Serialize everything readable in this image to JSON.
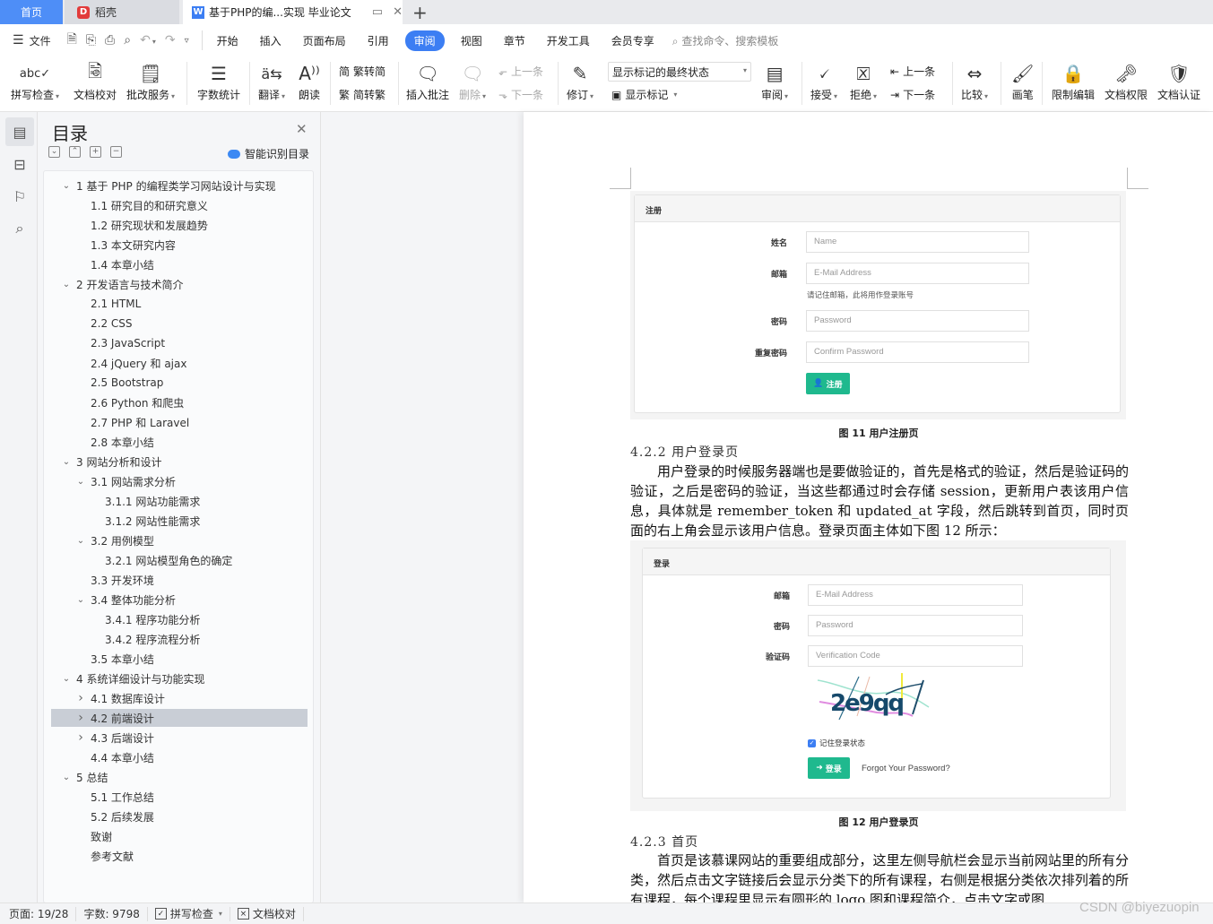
{
  "tabs": {
    "home": "首页",
    "daoke": "稻壳",
    "document": "基于PHP的编...实现 毕业论文"
  },
  "menu": {
    "file": "文件",
    "items": [
      "开始",
      "插入",
      "页面布局",
      "引用",
      "审阅",
      "视图",
      "章节",
      "开发工具",
      "会员专享"
    ],
    "active": "审阅",
    "search_placeholder": "查找命令、搜索模板"
  },
  "ribbon": {
    "spell_check": "拼写检查",
    "doc_proofread": "文档校对",
    "grading_service": "批改服务",
    "word_count": "字数统计",
    "translate": "翻译",
    "read_aloud": "朗读",
    "trad_to_simp": "繁转简",
    "simp_to_trad": "简转繁",
    "insert_comment": "插入批注",
    "delete": "删除",
    "prev_comment": "上一条",
    "next_comment": "下一条",
    "revise": "修订",
    "markup_select": "显示标记的最终状态",
    "show_markup": "显示标记",
    "review": "审阅",
    "accept": "接受",
    "reject": "拒绝",
    "prev_change": "上一条",
    "next_change": "下一条",
    "compare": "比较",
    "pen": "画笔",
    "restrict_edit": "限制编辑",
    "doc_permission": "文档权限",
    "doc_auth": "文档认证"
  },
  "toc": {
    "title": "目录",
    "smart_label": "智能识别目录",
    "items": [
      {
        "arrow": "v",
        "indent": 0,
        "text": "1  基于 PHP 的编程类学习网站设计与实现"
      },
      {
        "arrow": "",
        "indent": 1,
        "text": "1.1  研究目的和研究意义"
      },
      {
        "arrow": "",
        "indent": 1,
        "text": "1.2  研究现状和发展趋势"
      },
      {
        "arrow": "",
        "indent": 1,
        "text": "1.3  本文研究内容"
      },
      {
        "arrow": "",
        "indent": 1,
        "text": "1.4  本章小结"
      },
      {
        "arrow": "v",
        "indent": 0,
        "text": "2  开发语言与技术简介"
      },
      {
        "arrow": "",
        "indent": 1,
        "text": "2.1 HTML"
      },
      {
        "arrow": "",
        "indent": 1,
        "text": "2.2 CSS"
      },
      {
        "arrow": "",
        "indent": 1,
        "text": "2.3 JavaScript"
      },
      {
        "arrow": "",
        "indent": 1,
        "text": "2.4 jQuery 和 ajax"
      },
      {
        "arrow": "",
        "indent": 1,
        "text": "2.5 Bootstrap"
      },
      {
        "arrow": "",
        "indent": 1,
        "text": "2.6 Python 和爬虫"
      },
      {
        "arrow": "",
        "indent": 1,
        "text": "2.7 PHP 和 Laravel"
      },
      {
        "arrow": "",
        "indent": 1,
        "text": "2.8  本章小结"
      },
      {
        "arrow": "v",
        "indent": 0,
        "text": "3  网站分析和设计"
      },
      {
        "arrow": "v",
        "indent": 1,
        "text": "3.1  网站需求分析"
      },
      {
        "arrow": "",
        "indent": 2,
        "text": "3.1.1  网站功能需求"
      },
      {
        "arrow": "",
        "indent": 2,
        "text": "3.1.2  网站性能需求"
      },
      {
        "arrow": "v",
        "indent": 1,
        "text": "3.2  用例模型"
      },
      {
        "arrow": "",
        "indent": 2,
        "text": "3.2.1 网站模型角色的确定"
      },
      {
        "arrow": "",
        "indent": 1,
        "text": "3.3  开发环境"
      },
      {
        "arrow": "v",
        "indent": 1,
        "text": "3.4  整体功能分析"
      },
      {
        "arrow": "",
        "indent": 2,
        "text": "3.4.1  程序功能分析"
      },
      {
        "arrow": "",
        "indent": 2,
        "text": "3.4.2  程序流程分析"
      },
      {
        "arrow": "",
        "indent": 1,
        "text": "3.5  本章小结"
      },
      {
        "arrow": "v",
        "indent": 0,
        "text": "4  系统详细设计与功能实现"
      },
      {
        "arrow": ">",
        "indent": 1,
        "text": "4.1  数据库设计"
      },
      {
        "arrow": ">",
        "indent": 1,
        "text": "4.2  前端设计",
        "selected": true
      },
      {
        "arrow": ">",
        "indent": 1,
        "text": "4.3  后端设计"
      },
      {
        "arrow": "",
        "indent": 1,
        "text": "4.4  本章小结"
      },
      {
        "arrow": "v",
        "indent": 0,
        "text": "5  总结"
      },
      {
        "arrow": "",
        "indent": 1,
        "text": "5.1  工作总结"
      },
      {
        "arrow": "",
        "indent": 1,
        "text": "5.2  后续发展"
      },
      {
        "arrow": "",
        "indent": 1,
        "text": "致谢"
      },
      {
        "arrow": "",
        "indent": 1,
        "text": "参考文献"
      }
    ]
  },
  "document": {
    "fig11": {
      "panel_title": "注册",
      "name_label": "姓名",
      "name_placeholder": "Name",
      "email_label": "邮箱",
      "email_placeholder": "E-Mail Address",
      "email_help": "请记住邮箱，此将用作登录账号",
      "password_label": "密码",
      "password_placeholder": "Password",
      "confirm_label": "重复密码",
      "confirm_placeholder": "Confirm Password",
      "button": "注册",
      "caption": "图 11  用户注册页"
    },
    "section_422": "4.2.2 用户登录页",
    "para_422": "用户登录的时候服务器端也是要做验证的，首先是格式的验证，然后是验证码的验证，之后是密码的验证，当这些都通过时会存储 session，更新用户表该用户信息，具体就是 remember_token 和 updated_at 字段，然后跳转到首页，同时页面的右上角会显示该用户信息。登录页面主体如下图 12 所示：",
    "fig12": {
      "panel_title": "登录",
      "email_label": "邮箱",
      "email_placeholder": "E-Mail Address",
      "password_label": "密码",
      "password_placeholder": "Password",
      "code_label": "验证码",
      "code_placeholder": "Verification Code",
      "captcha_text": "2e9qq",
      "remember_label": "记住登录状态",
      "remember_checked": true,
      "button": "登录",
      "forgot": "Forgot Your Password?",
      "caption": "图 12  用户登录页"
    },
    "section_423": "4.2.3 首页",
    "para_423": "首页是该慕课网站的重要组成部分，这里左侧导航栏会显示当前网站里的所有分类，然后点击文字链接后会显示分类下的所有课程，右侧是根据分类依次排列着的所有课程，每个课程里显示有圆形的 logo 图和课程简介，点击文字或图"
  },
  "status": {
    "page": "页面: 19/28",
    "words": "字数: 9798",
    "spell_check": "拼写检查",
    "doc_proofread": "文档校对"
  },
  "watermark": "CSDN @biyezuopin",
  "colors": {
    "accent": "#3c7ef3",
    "button_green": "#1fb98e",
    "toc_selected": "#c9ced6"
  }
}
